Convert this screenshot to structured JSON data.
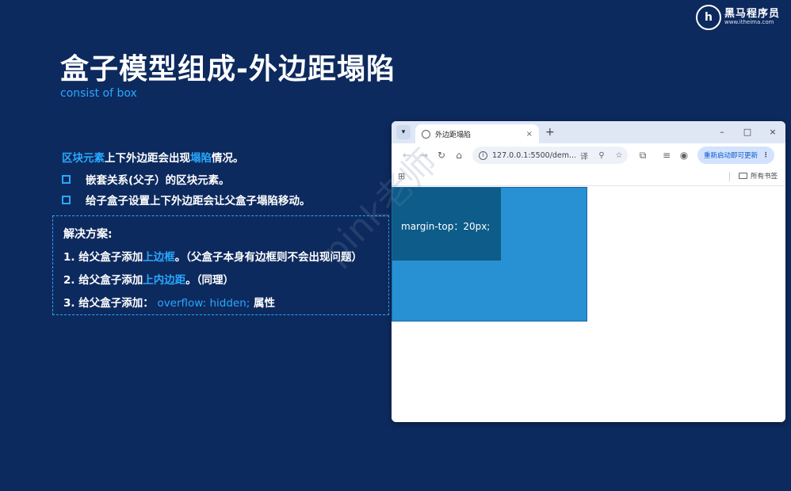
{
  "logo": {
    "mark": "h",
    "name": "黑马程序员",
    "url": "www.itheima.com"
  },
  "title": "盒子模型组成-外边距塌陷",
  "subtitle": "consist of box",
  "intro": {
    "part1": "区块元素",
    "part2": "上下外边距会出现",
    "part3": "塌陷",
    "part4": "情况。"
  },
  "bullets": [
    "嵌套关系(父子）的区块元素。",
    "给子盒子设置上下外边距会让父盒子塌陷移动。"
  ],
  "solution": {
    "heading": "解决方案:",
    "line1": {
      "prefix": "1. 给父盒子添加",
      "highlight": "上边框",
      "suffix": "。（父盒子本身有边框则不会出现问题）"
    },
    "line2": {
      "prefix": "2. 给父盒子添加",
      "highlight": "上内边距",
      "suffix": "。（同理）"
    },
    "line3": {
      "prefix": "3. 给父盒子添加：",
      "code": "overflow: hidden;",
      "suffix": "属性"
    }
  },
  "browser": {
    "tab_menu_icon": "chevron-down-icon",
    "tab_title": "外边距塌陷",
    "tab_close": "×",
    "new_tab": "+",
    "win_controls": [
      "–",
      "□",
      "×"
    ],
    "nav_icons": [
      "←",
      "→",
      "↻",
      "⌂"
    ],
    "url": "127.0.0.1:5500/dem...",
    "omnibox_icons": [
      "译",
      "⚲",
      "☆"
    ],
    "toolbar_icons": [
      "⧉",
      "≡",
      "◉"
    ],
    "update_label": "重新启动即可更新",
    "update_menu": "⋮",
    "apps_icon": "⊞",
    "all_bookmarks": "所有书签",
    "inner_box_label": "margin-top：20px;"
  },
  "watermark": "pink老师"
}
